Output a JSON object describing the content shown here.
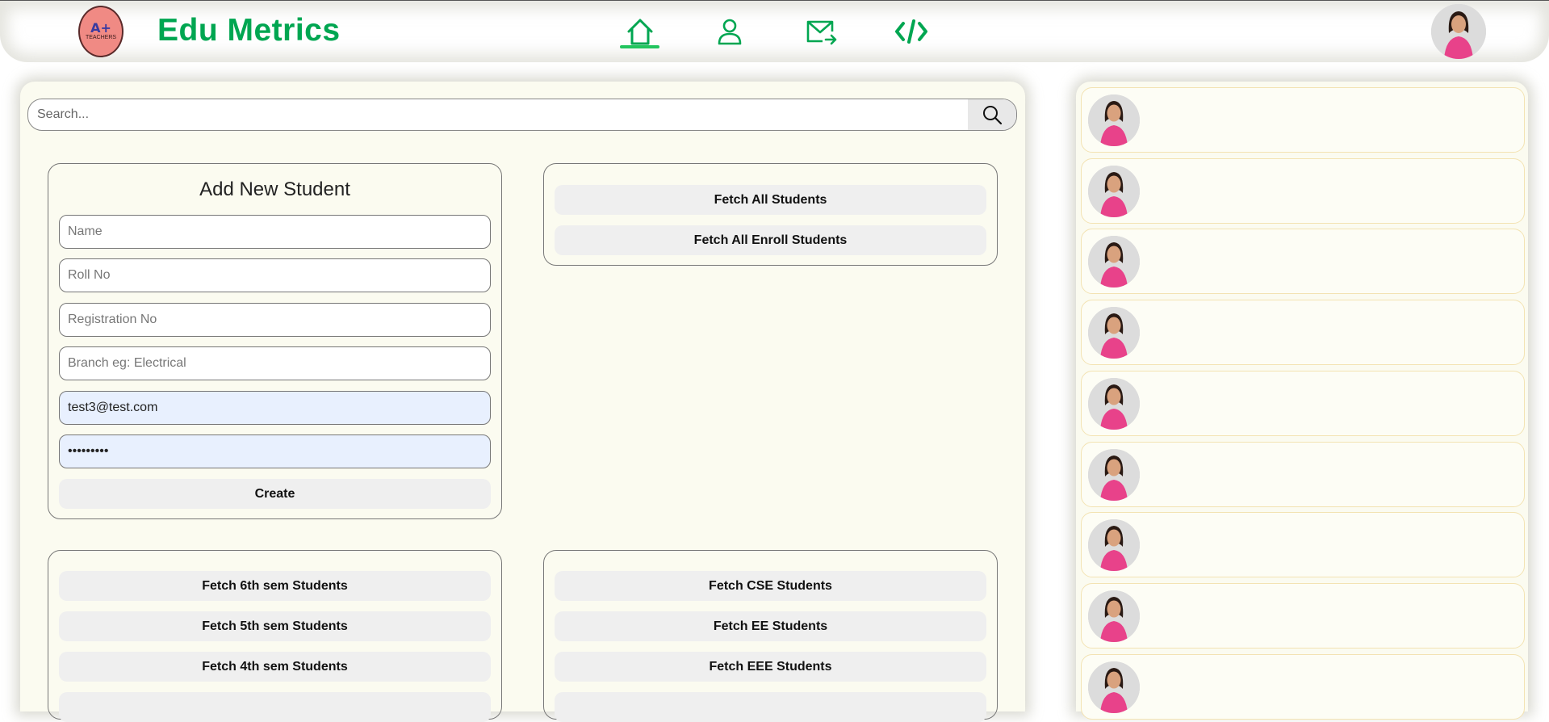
{
  "header": {
    "logo": {
      "big": "A+",
      "small": "TEACHERS"
    },
    "brand": "Edu Metrics",
    "nav": [
      "home-icon",
      "user-icon",
      "mail-send-icon",
      "code-icon"
    ],
    "accent_color": "#00a651"
  },
  "search": {
    "placeholder": "Search..."
  },
  "add_student": {
    "title": "Add New Student",
    "fields": {
      "name": {
        "placeholder": "Name",
        "value": ""
      },
      "roll": {
        "placeholder": "Roll No",
        "value": ""
      },
      "registration": {
        "placeholder": "Registration No",
        "value": ""
      },
      "branch": {
        "placeholder": "Branch eg: Electrical",
        "value": ""
      },
      "email": {
        "value": "test3@test.com"
      },
      "password": {
        "value": "test12345"
      }
    },
    "create_label": "Create"
  },
  "fetch_all": {
    "all_students": "Fetch All Students",
    "all_enroll": "Fetch All Enroll Students"
  },
  "sem_buttons": [
    "Fetch 6th sem Students",
    "Fetch 5th sem Students",
    "Fetch 4th sem Students"
  ],
  "branch_buttons": [
    "Fetch CSE Students",
    "Fetch EE Students",
    "Fetch EEE Students"
  ],
  "sidebar_count": 9
}
